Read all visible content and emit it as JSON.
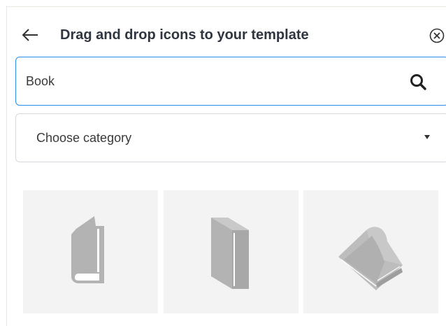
{
  "header": {
    "title": "Drag and drop icons to your template",
    "back_icon": "arrow-left-icon",
    "close_icon": "circle-x-icon"
  },
  "search": {
    "value": "Book",
    "placeholder": "",
    "icon": "search-icon"
  },
  "category": {
    "selected": "Choose category",
    "icon": "chevron-down-icon"
  },
  "results": {
    "items": [
      {
        "icon": "book-standing-icon"
      },
      {
        "icon": "book-closed-icon"
      },
      {
        "icon": "book-open-icon"
      }
    ]
  },
  "colors": {
    "accent": "#2b8be6",
    "title_text": "#2f3640",
    "icon_gray": "#b3b3b3",
    "tile_bg": "#f3f3f3",
    "panel_border": "#e2ebde"
  }
}
